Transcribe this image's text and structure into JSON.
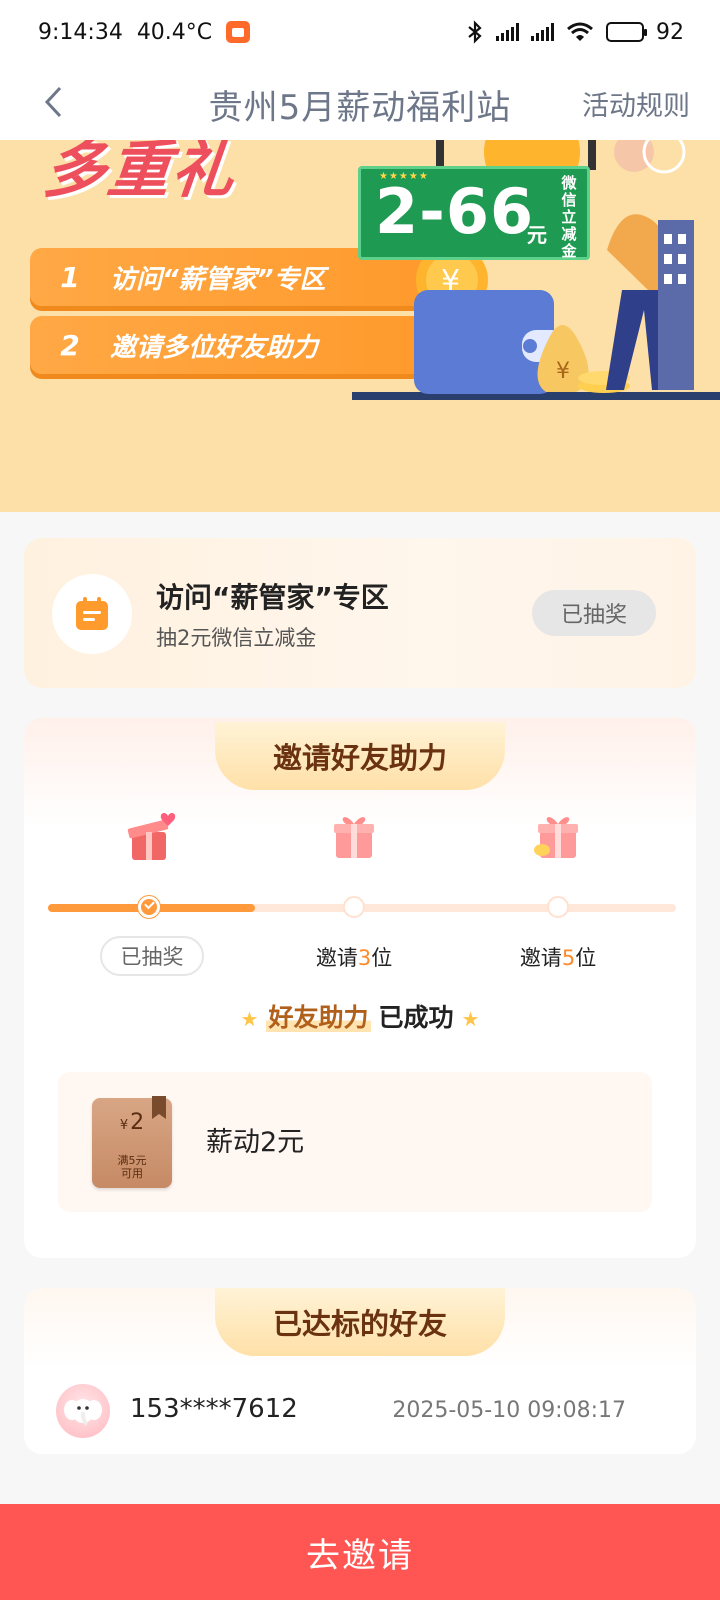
{
  "status_bar": {
    "time": "9:14:34",
    "temperature": "40.4°C",
    "battery": "92",
    "battery_level": 0.92
  },
  "header": {
    "back_icon": "chevron-left-icon",
    "title": "贵州5月薪动福利站",
    "rules_link": "活动规则"
  },
  "banner": {
    "headline": "多重礼",
    "steps": [
      {
        "num": "1",
        "text": "访问“薪管家”专区"
      },
      {
        "num": "2",
        "text": "邀请多位好友助力"
      }
    ],
    "coupon_amount": "2-66",
    "coupon_unit": "元",
    "coupon_side_label": "微信立减金",
    "colors": {
      "background": "#fde0a8",
      "headline": "#ee4f5d",
      "pill": "#ffa845",
      "sign": "#1f9a52"
    }
  },
  "visit_card": {
    "icon": "calendar-icon",
    "title": "访问“薪管家”专区",
    "subtitle": "抽2元微信立减金",
    "status": "已抽奖"
  },
  "invite_card": {
    "title": "邀请好友助力",
    "progress_fraction": 0.33,
    "steps": [
      {
        "label": "已抽奖",
        "done": true
      },
      {
        "prefix": "邀请",
        "count": "3",
        "suffix": "位",
        "done": false
      },
      {
        "prefix": "邀请",
        "count": "5",
        "suffix": "位",
        "done": false
      }
    ],
    "success_highlight": "好友助力",
    "success_text": "已成功",
    "reward": {
      "currency": "¥",
      "amount": "2",
      "condition_line1": "满5元",
      "condition_line2": "可用",
      "name": "薪动2元"
    }
  },
  "friends_card": {
    "title": "已达标的好友",
    "friends": [
      {
        "phone": "153****7612",
        "time": "2025-05-10 09:08:17"
      }
    ]
  },
  "cta": {
    "label": "去邀请",
    "color": "#ff5553"
  }
}
